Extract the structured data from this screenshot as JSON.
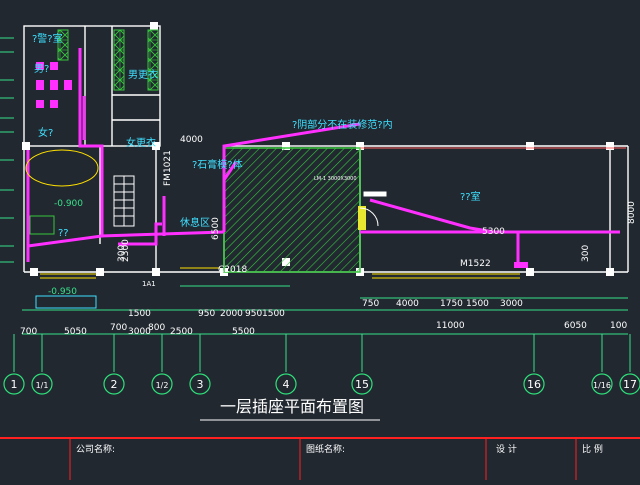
{
  "colors": {
    "background": "#212830",
    "wall": "#ffffff",
    "dimension": "#38e08a",
    "grid_axis": "#f0f0f0",
    "text_cyan": "#3fe0ff",
    "socket_route": "#ff30ff",
    "hatch": "#37c63d",
    "axis_bubble": "#2fe07a",
    "red_frame": "#ff2020",
    "yellow": "#ffe000"
  },
  "drawing_title": "一层插座平面布置图",
  "room_labels": {
    "top_left": "?警?室",
    "male": "男?",
    "male_changing": "男更衣",
    "female": "女?",
    "female_changing": "女更衣",
    "shower": "??",
    "stone_body": "?石膏模?体",
    "rest_area": "休息区",
    "project_note": "?阴部分不在装修范?内",
    "room_right": "??室"
  },
  "door_tags": {
    "fm": "FM1021",
    "m1522": "M1522",
    "c2018": "C2018",
    "lm_small": "LM-1 3000X3000"
  },
  "level_marks": {
    "left_mid": "-0.900",
    "left_low": "-0.950"
  },
  "dim_texts": {
    "top_4000": "4000",
    "top_2300": "2300",
    "top_5300": "5300",
    "v_8000": "8000",
    "v_300": "300",
    "v_6500": "6500",
    "row1": [
      "1500",
      "950",
      "2000",
      "950",
      "1500",
      "750",
      "4000",
      "1750",
      "1500",
      "3000"
    ],
    "row2": [
      "700",
      "5050",
      "700",
      "3000",
      "800",
      "2500",
      "5500",
      "11000",
      "6050",
      "100"
    ],
    "row2_extra": [
      "300",
      "1A1"
    ]
  },
  "axes": [
    "1",
    "1/1",
    "2",
    "1/2",
    "3",
    "4",
    "15",
    "16",
    "1/16",
    "17"
  ],
  "title_block": {
    "company_label": "公司名称:",
    "drawing_name_label": "图纸名称:",
    "design_label": "设 计",
    "scale_label": "比 例"
  }
}
